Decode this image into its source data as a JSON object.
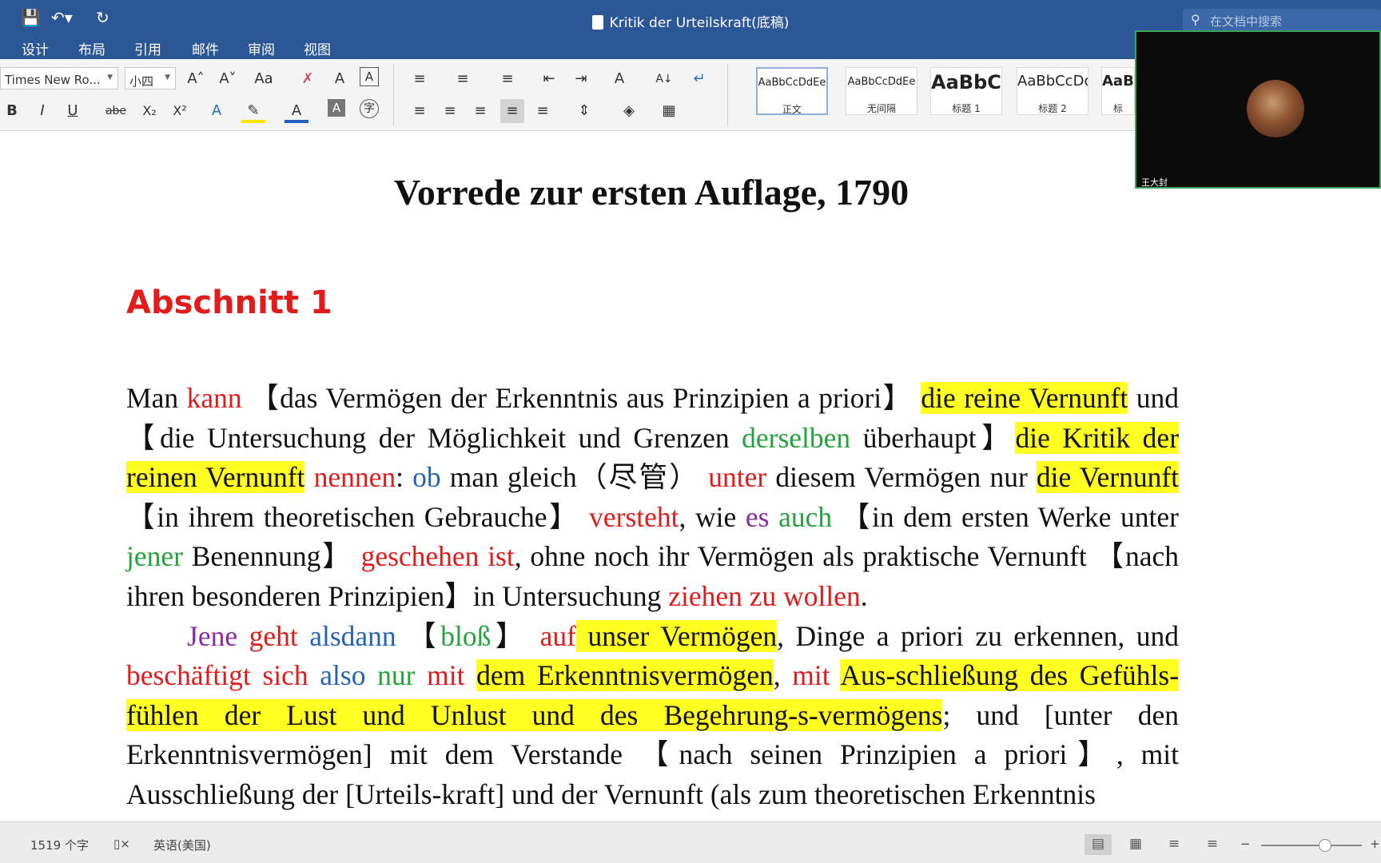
{
  "app": {
    "window_title": "Kritik der Urteilskraft(底稿)",
    "search_placeholder": "在文档中搜索"
  },
  "ribbon_tabs": [
    "设计",
    "布局",
    "引用",
    "邮件",
    "审阅",
    "视图"
  ],
  "ribbon": {
    "font_name": "Times New Ro...",
    "font_size": "小四",
    "styles": [
      {
        "sample": "AaBbCcDdEe",
        "name": "正文"
      },
      {
        "sample": "AaBbCcDdEe",
        "name": "无间隔"
      },
      {
        "sample": "AaBbCc",
        "name": "标题 1"
      },
      {
        "sample": "AaBbCcDd",
        "name": "标题 2"
      },
      {
        "sample": "AaBl",
        "name": "标"
      }
    ]
  },
  "document": {
    "title": "Vorrede zur ersten Auflage, 1790",
    "section": "Abschnitt 1",
    "p1": [
      [
        "",
        "Man "
      ],
      [
        "r",
        "kann"
      ],
      [
        "",
        " 【das Vermögen der Erkenntnis aus Prinzipien a priori】 "
      ],
      [
        "hl",
        "die reine Vernunft"
      ],
      [
        "",
        " und【die Untersuchung der Möglichkeit und Grenzen "
      ],
      [
        "g",
        "derselben"
      ],
      [
        "",
        " überhaupt】"
      ],
      [
        "hl",
        "die Kritik der reinen Vernunft"
      ],
      [
        "",
        " "
      ],
      [
        "r",
        "nennen"
      ],
      [
        "",
        ": "
      ],
      [
        "b",
        "ob"
      ],
      [
        "",
        " man gleich（尽管） "
      ],
      [
        "r",
        "unter"
      ],
      [
        "",
        " diesem Vermögen nur "
      ],
      [
        "hl",
        "die Vernunft"
      ],
      [
        "",
        " 【in ihrem theoretischen Gebrauche】 "
      ],
      [
        "r",
        "versteht"
      ],
      [
        "",
        ", wie "
      ],
      [
        "p",
        "es"
      ],
      [
        "",
        " "
      ],
      [
        "g",
        "auch"
      ],
      [
        "",
        " 【in dem ersten Werke unter "
      ],
      [
        "g",
        "jener"
      ],
      [
        "",
        " Benennung】 "
      ],
      [
        "r",
        "geschehen ist"
      ],
      [
        "",
        ", ohne noch ihr Vermögen als praktische Vernunft 【nach ihren besonderen Prinzipien】in Untersuchung "
      ],
      [
        "r",
        "ziehen zu wollen"
      ],
      [
        "",
        "."
      ]
    ],
    "p2": [
      [
        "p",
        "Jene"
      ],
      [
        "",
        " "
      ],
      [
        "r",
        "geht"
      ],
      [
        "",
        " "
      ],
      [
        "b",
        "alsdann"
      ],
      [
        "",
        " 【"
      ],
      [
        "g",
        "bloß"
      ],
      [
        "",
        "】 "
      ],
      [
        "r",
        "auf"
      ],
      [
        "hl",
        " unser Vermögen"
      ],
      [
        "",
        ", Dinge a priori zu erkennen, und "
      ],
      [
        "r",
        "beschäftigt sich"
      ],
      [
        "",
        " "
      ],
      [
        "b",
        "also"
      ],
      [
        "",
        " "
      ],
      [
        "g",
        "nur"
      ],
      [
        "",
        " "
      ],
      [
        "r",
        "mit"
      ],
      [
        "",
        " "
      ],
      [
        "hl",
        "dem Erkenntnisvermögen"
      ],
      [
        "",
        ", "
      ],
      [
        "r",
        "mit"
      ],
      [
        "",
        " "
      ],
      [
        "hl",
        "Aus-schließung des Gefühls-fühlen der Lust und Unlust und des Begehrung-s-vermögens"
      ],
      [
        "",
        "; und [unter den Erkenntnisvermögen] mit dem Verstande 【nach seinen Prinzipien a priori】, mit Ausschließung der [Urteils-kraft] und der Vernunft (als zum theoretischen Erkenntnis"
      ]
    ]
  },
  "status": {
    "word_count": "1519 个字",
    "language": "英语(美国)"
  },
  "video": {
    "participant": "王大封"
  }
}
